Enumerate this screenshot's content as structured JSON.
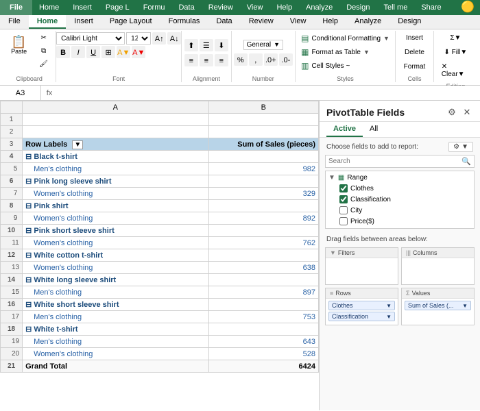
{
  "menubar": {
    "tabs": [
      "File",
      "Home",
      "Insert",
      "Page L",
      "Formu",
      "Data",
      "Review",
      "View",
      "Help",
      "Analyze",
      "Design",
      "Tell me",
      "Share"
    ]
  },
  "ribbon": {
    "active_tab": "Home",
    "groups": {
      "clipboard": {
        "label": "Clipboard",
        "paste_label": "Paste"
      },
      "font": {
        "label": "Font",
        "font_name": "Calibri Light",
        "font_size": "12",
        "bold": "B",
        "italic": "I",
        "underline": "U"
      },
      "alignment": {
        "label": "Alignment",
        "button": "Alignment"
      },
      "number": {
        "label": "Number",
        "button": "Number"
      },
      "styles": {
        "label": "Styles",
        "conditional_formatting": "Conditional Formatting",
        "format_as_table": "Format as Table",
        "cell_styles": "Cell Styles ~"
      },
      "cells": {
        "label": "Cells",
        "button": "Cells"
      },
      "editing": {
        "label": "Editing",
        "button": "Editing"
      }
    }
  },
  "formula_bar": {
    "cell_ref": "A3",
    "formula": ""
  },
  "spreadsheet": {
    "columns": [
      "",
      "A",
      "B"
    ],
    "rows": [
      {
        "num": "1",
        "a": "",
        "b": ""
      },
      {
        "num": "2",
        "a": "",
        "b": ""
      },
      {
        "num": "3",
        "a": "Row Labels",
        "b": "Sum of Sales (pieces)",
        "type": "header"
      },
      {
        "num": "4",
        "a": "⊟ Black t-shirt",
        "b": "",
        "type": "category"
      },
      {
        "num": "5",
        "a": "Men's clothing",
        "b": "982",
        "type": "sub"
      },
      {
        "num": "6",
        "a": "⊟ Pink long sleeve shirt",
        "b": "",
        "type": "category"
      },
      {
        "num": "7",
        "a": "Women's clothing",
        "b": "329",
        "type": "sub"
      },
      {
        "num": "8",
        "a": "⊟ Pink shirt",
        "b": "",
        "type": "category"
      },
      {
        "num": "9",
        "a": "Women's clothing",
        "b": "892",
        "type": "sub"
      },
      {
        "num": "10",
        "a": "⊟ Pink short sleeve shirt",
        "b": "",
        "type": "category"
      },
      {
        "num": "11",
        "a": "Women's clothing",
        "b": "762",
        "type": "sub"
      },
      {
        "num": "12",
        "a": "⊟ White cotton t-shirt",
        "b": "",
        "type": "category"
      },
      {
        "num": "13",
        "a": "Women's clothing",
        "b": "638",
        "type": "sub"
      },
      {
        "num": "14",
        "a": "⊟ White long sleeve shirt",
        "b": "",
        "type": "category"
      },
      {
        "num": "15",
        "a": "Men's clothing",
        "b": "897",
        "type": "sub"
      },
      {
        "num": "16",
        "a": "⊟ White short sleeve shirt",
        "b": "",
        "type": "category"
      },
      {
        "num": "17",
        "a": "Men's clothing",
        "b": "753",
        "type": "sub"
      },
      {
        "num": "18",
        "a": "⊟ White t-shirt",
        "b": "",
        "type": "category"
      },
      {
        "num": "19",
        "a": "Men's clothing",
        "b": "643",
        "type": "sub"
      },
      {
        "num": "20",
        "a": "Women's clothing",
        "b": "528",
        "type": "sub"
      },
      {
        "num": "21",
        "a": "Grand Total",
        "b": "6424",
        "type": "grand_total"
      }
    ]
  },
  "pivot_panel": {
    "title": "PivotTable Fields",
    "close_icon": "✕",
    "settings_icon": "⚙",
    "tabs": [
      "Active",
      "All"
    ],
    "active_tab": "Active",
    "fields_header": "Choose fields to add to report:",
    "search_placeholder": "Search",
    "field_groups": [
      {
        "name": "Range",
        "icon": "▶",
        "fields": [
          {
            "name": "Clothes",
            "checked": true
          },
          {
            "name": "Classification",
            "checked": true
          },
          {
            "name": "City",
            "checked": false
          },
          {
            "name": "Price($)",
            "checked": false
          }
        ]
      }
    ],
    "drag_label": "Drag fields between areas below:",
    "areas": [
      {
        "icon": "▼",
        "icon_label": "Filters",
        "label": "Filters",
        "chips": []
      },
      {
        "icon": "|||",
        "icon_label": "Columns",
        "label": "Columns",
        "chips": []
      },
      {
        "icon": "≡",
        "icon_label": "Rows",
        "label": "Rows",
        "chips": [
          "Clothes",
          "Classification"
        ]
      },
      {
        "icon": "Σ",
        "icon_label": "Values",
        "label": "Values",
        "chips": [
          "Sum of Sales (..."
        ]
      }
    ]
  }
}
